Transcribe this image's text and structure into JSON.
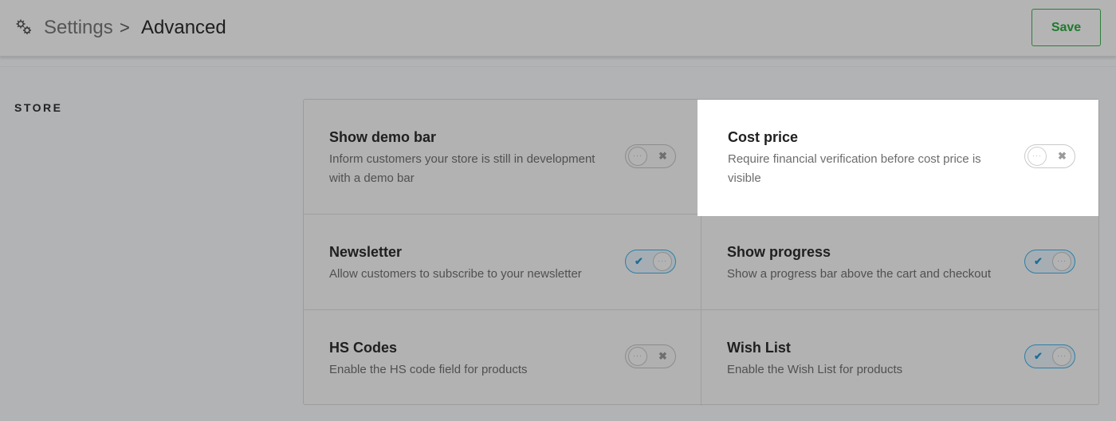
{
  "breadcrumb": {
    "parent": "Settings",
    "separator": ">",
    "current": "Advanced"
  },
  "header": {
    "save_label": "Save"
  },
  "section": {
    "label": "STORE"
  },
  "icons": {
    "settings": "gear-icon",
    "toggle_on_mark": "✔",
    "toggle_off_mark": "✖",
    "knob": "···"
  },
  "colors": {
    "save_accent": "#1f7a2e",
    "toggle_on_accent": "#2c7fa6"
  },
  "settings": [
    {
      "title": "Show demo bar",
      "desc_line1": "Inform customers your store is still in development",
      "desc_line2": "with a demo bar",
      "enabled": false,
      "highlighted": false
    },
    {
      "title": "Cost price",
      "desc_line1": "Require financial verification before cost price is",
      "desc_line2": "visible",
      "enabled": false,
      "highlighted": true
    },
    {
      "title": "Newsletter",
      "desc_line1": "Allow customers to subscribe to your newsletter",
      "enabled": true,
      "highlighted": false
    },
    {
      "title": "Show progress",
      "desc_line1": "Show a progress bar above the cart and checkout",
      "enabled": true,
      "highlighted": false
    },
    {
      "title": "HS Codes",
      "desc_line1": "Enable the HS code field for products",
      "enabled": false,
      "highlighted": false
    },
    {
      "title": "Wish List",
      "desc_line1": "Enable the Wish List for products",
      "enabled": true,
      "highlighted": false
    }
  ]
}
